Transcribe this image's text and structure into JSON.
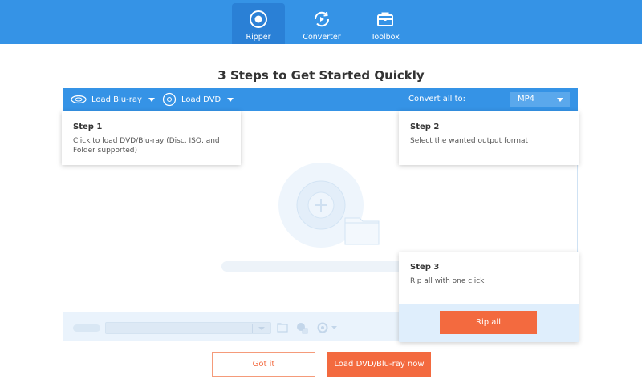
{
  "nav": {
    "tabs": [
      {
        "label": "Ripper",
        "icon": "ripper-icon",
        "active": true
      },
      {
        "label": "Converter",
        "icon": "converter-icon",
        "active": false
      },
      {
        "label": "Toolbox",
        "icon": "toolbox-icon",
        "active": false
      }
    ]
  },
  "title": "3 Steps to Get Started Quickly",
  "toolbar": {
    "load_bluray": "Load Blu-ray",
    "load_dvd": "Load DVD",
    "convert_all_label": "Convert all to:",
    "format_value": "MP4"
  },
  "steps": [
    {
      "title": "Step 1",
      "text": "Click to load DVD/Blu-ray (Disc, ISO, and Folder supported)"
    },
    {
      "title": "Step 2",
      "text": "Select the wanted output format"
    },
    {
      "title": "Step 3",
      "text": "Rip all with one click"
    }
  ],
  "rip_all_label": "Rip all",
  "buttons": {
    "got_it": "Got it",
    "load_now": "Load DVD/Blu-ray now"
  },
  "colors": {
    "primary": "#3593e6",
    "accent": "#f36a3f",
    "panel_tint": "#dfeefc"
  }
}
